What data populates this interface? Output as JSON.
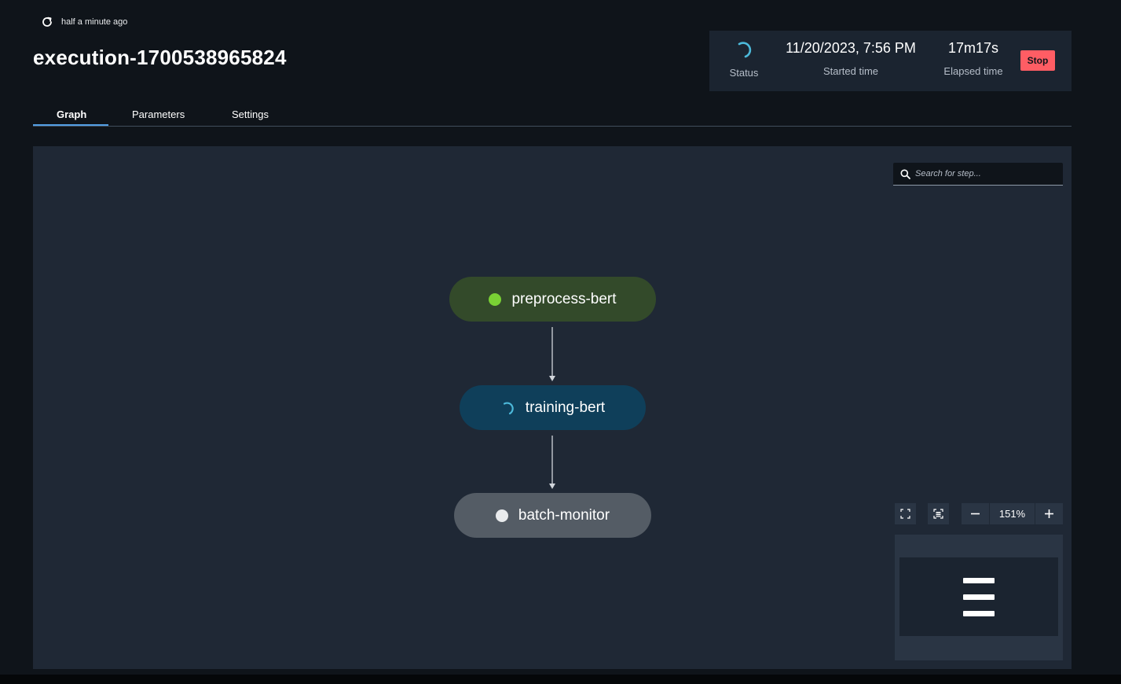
{
  "header": {
    "refresh_text": "half a minute ago",
    "title": "execution-1700538965824"
  },
  "status_panel": {
    "status_label": "Status",
    "started_time_value": "11/20/2023, 7:56 PM",
    "started_time_label": "Started time",
    "elapsed_time_value": "17m17s",
    "elapsed_time_label": "Elapsed time",
    "stop_label": "Stop"
  },
  "tabs": [
    {
      "label": "Graph",
      "selected": true
    },
    {
      "label": "Parameters",
      "selected": false
    },
    {
      "label": "Settings",
      "selected": false
    }
  ],
  "search": {
    "placeholder": "Search for step..."
  },
  "graph": {
    "nodes": [
      {
        "label": "preprocess-bert",
        "state": "succeeded"
      },
      {
        "label": "training-bert",
        "state": "running"
      },
      {
        "label": "batch-monitor",
        "state": "not-started"
      }
    ]
  },
  "zoom": {
    "level": "151%"
  },
  "colors": {
    "accent_blue": "#539fe5",
    "spinner_blue": "#4cb8d9",
    "stop_red": "#ff5d64",
    "succeeded_green": "#7ad134",
    "node_succeeded_bg": "#334a2a",
    "node_running_bg": "#0f3f5a",
    "node_pending_bg": "#545c65"
  },
  "icons": [
    "refresh-icon",
    "spinner-icon",
    "search-icon",
    "fullscreen-icon",
    "fit-to-screen-icon",
    "zoom-out-icon",
    "zoom-in-icon"
  ]
}
